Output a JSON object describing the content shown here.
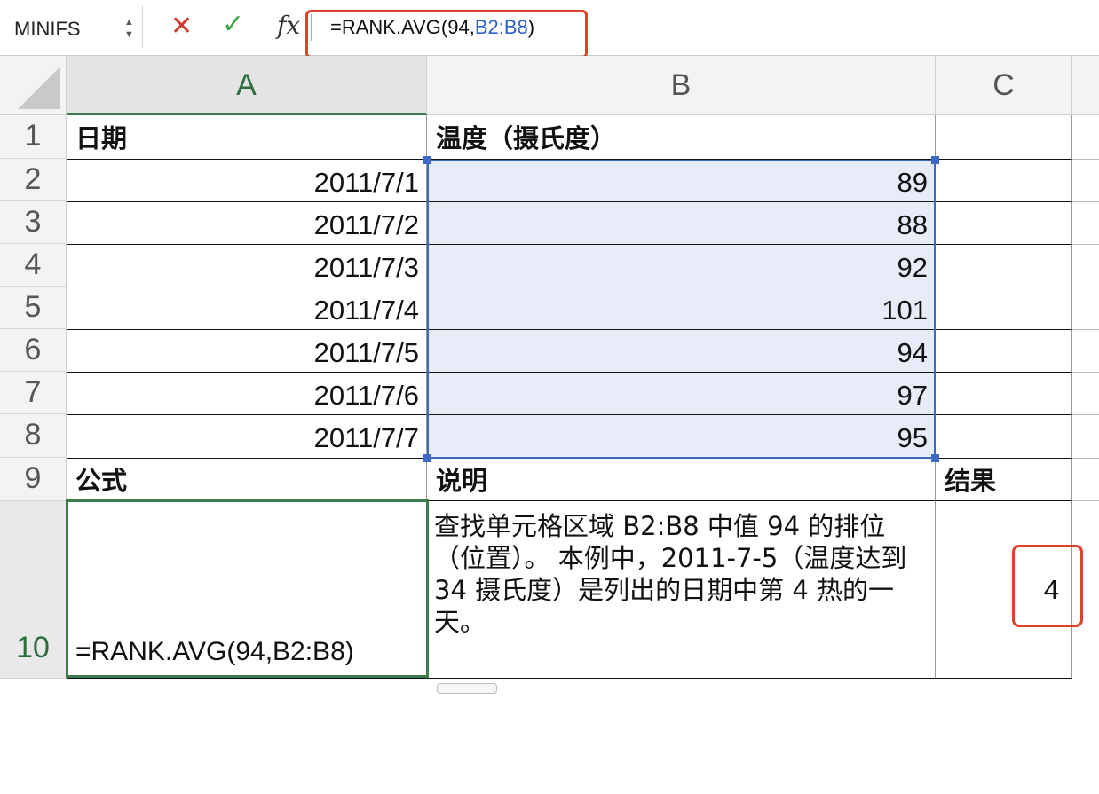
{
  "formula_bar": {
    "name_box": "MINIFS",
    "cancel_icon": "✕",
    "enter_icon": "✓",
    "fx_label": "fx",
    "formula_prefix": "=RANK.AVG(94,",
    "formula_ref": "B2:B8",
    "formula_suffix": ")"
  },
  "columns": [
    "A",
    "B",
    "C"
  ],
  "rows": [
    "1",
    "2",
    "3",
    "4",
    "5",
    "6",
    "7",
    "8",
    "9",
    "10"
  ],
  "header_row": {
    "a": "日期",
    "b": "温度（摄氏度）"
  },
  "data_rows": [
    {
      "date": "2011/7/1",
      "temp": "89"
    },
    {
      "date": "2011/7/2",
      "temp": "88"
    },
    {
      "date": "2011/7/3",
      "temp": "92"
    },
    {
      "date": "2011/7/4",
      "temp": "101"
    },
    {
      "date": "2011/7/5",
      "temp": "94"
    },
    {
      "date": "2011/7/6",
      "temp": "97"
    },
    {
      "date": "2011/7/7",
      "temp": "95"
    }
  ],
  "row9": {
    "a": "公式",
    "b": "说明",
    "c": "结果"
  },
  "row10": {
    "formula": "=RANK.AVG(94,B2:B8)",
    "description": "查找单元格区域 B2:B8 中值 94 的排位（位置）。 本例中，2011-7-5（温度达到 34 摄氏度）是列出的日期中第 4 热的一天。",
    "result": "4"
  },
  "colors": {
    "selection_border": "#3d68c4",
    "active_cell_border": "#3e7a4c",
    "highlight_red": "#e3402c",
    "selection_fill": "#e8ecf8"
  }
}
